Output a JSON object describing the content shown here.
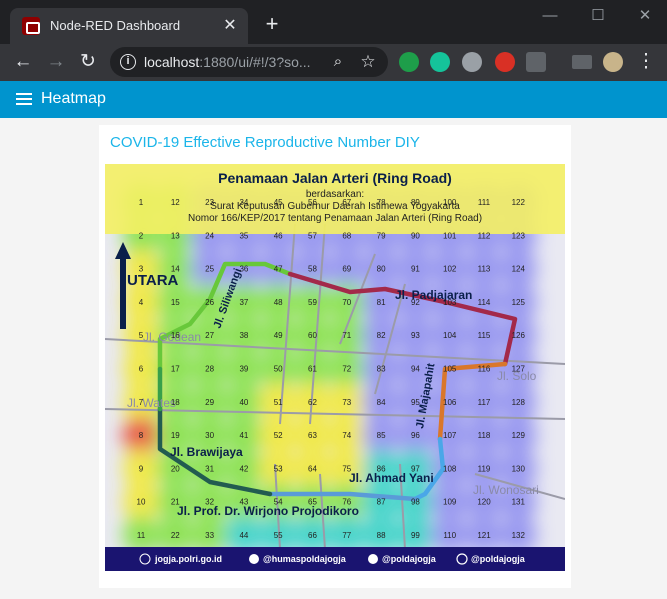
{
  "browser": {
    "tab_title": "Node-RED Dashboard",
    "url_host": "localhost",
    "url_path": ":1880/ui/#!/3?so..."
  },
  "app": {
    "title": "Heatmap"
  },
  "card": {
    "title": "COVID-19 Effective Reproductive Number DIY"
  },
  "map": {
    "banner_title": "Penamaan Jalan Arteri (Ring Road)",
    "banner_line1": "berdasarkan:",
    "banner_line2": "Surat Keputusan Gubernur Daerah Istimewa Yogyakarta",
    "banner_line3": "Nomor 166/KEP/2017 tentang Penamaan Jalan Arteri (Ring Road)",
    "north_label": "UTARA",
    "road_labels": {
      "siliwangi": "Jl. Siliwangi",
      "padjajaran": "Jl. Padjajaran",
      "majapahit": "Jl. Majapahit",
      "brawijaya": "Jl. Brawijaya",
      "ahmad_yani": "Jl. Ahmad Yani",
      "wirjono": "Jl. Prof. Dr. Wirjono Projodikoro",
      "godean": "Jl. Godean",
      "solo": "Jl. Solo",
      "wates": "Jl. Wates",
      "wonosari": "Jl. Wonosari"
    },
    "footer_links": [
      "jogja.polri.go.id",
      "@humaspoldajogja",
      "@poldajogja",
      "@poldajogja"
    ],
    "cell_numbers": [
      [
        1,
        12,
        23,
        34,
        45,
        56,
        67,
        78,
        89,
        100,
        111,
        122
      ],
      [
        2,
        13,
        24,
        35,
        46,
        57,
        68,
        79,
        90,
        101,
        112,
        123
      ],
      [
        3,
        14,
        25,
        36,
        47,
        58,
        69,
        80,
        91,
        102,
        113,
        124
      ],
      [
        4,
        15,
        26,
        37,
        48,
        59,
        70,
        81,
        92,
        103,
        114,
        125
      ],
      [
        5,
        16,
        27,
        38,
        49,
        60,
        71,
        82,
        93,
        104,
        115,
        126
      ],
      [
        6,
        17,
        28,
        39,
        50,
        61,
        72,
        83,
        94,
        105,
        116,
        127
      ],
      [
        7,
        18,
        29,
        40,
        51,
        62,
        73,
        84,
        95,
        106,
        117,
        128
      ],
      [
        8,
        19,
        30,
        41,
        52,
        63,
        74,
        85,
        96,
        107,
        118,
        129
      ],
      [
        9,
        20,
        31,
        42,
        53,
        64,
        75,
        86,
        97,
        108,
        119,
        130
      ],
      [
        10,
        21,
        32,
        43,
        54,
        65,
        76,
        87,
        98,
        109,
        120,
        131
      ],
      [
        11,
        22,
        33,
        44,
        55,
        66,
        77,
        88,
        99,
        110,
        121,
        132
      ]
    ],
    "heat_colors": {
      "hot": "#e8432a",
      "warm": "#f2e92a",
      "mild": "#7fe23a",
      "cool": "#2ad1c3",
      "cold": "#8b8bf0"
    }
  }
}
